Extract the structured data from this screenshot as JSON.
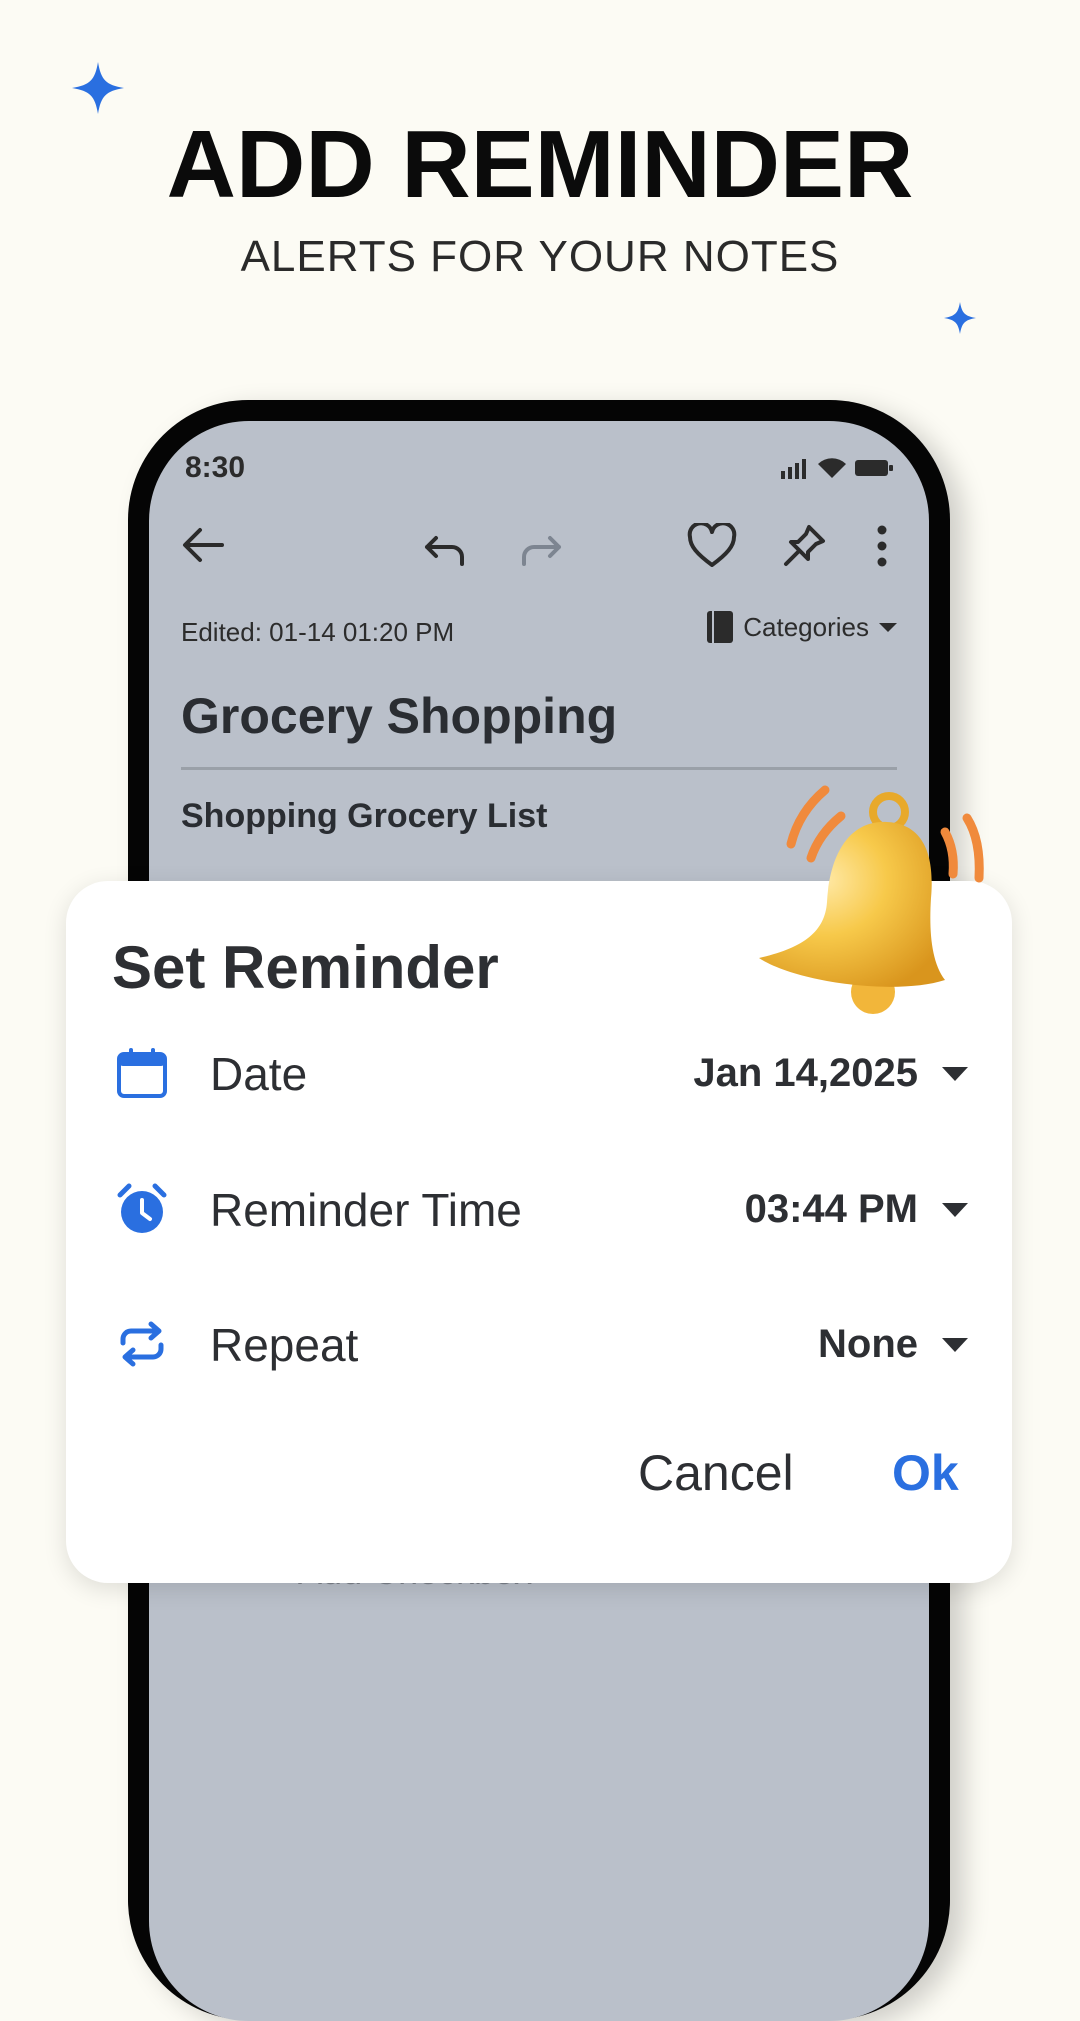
{
  "hero": {
    "title": "ADD REMINDER",
    "subtitle": "ALERTS FOR YOUR NOTES"
  },
  "status_bar": {
    "time": "8:30",
    "icons": [
      "signal-icon",
      "wifi-icon",
      "battery-icon"
    ]
  },
  "toolbar": {
    "icons": [
      "back-arrow-icon",
      "undo-icon",
      "redo-icon",
      "heart-icon",
      "pin-icon",
      "more-vertical-icon"
    ]
  },
  "note": {
    "edited": "Edited: 01-14  01:20 PM",
    "categories_label": "Categories",
    "title": "Grocery Shopping",
    "subtitle": "Shopping Grocery List",
    "add_checkbox": "+ Add Checkbox"
  },
  "dialog": {
    "title": "Set Reminder",
    "rows": [
      {
        "icon": "calendar-icon",
        "label": "Date",
        "value": "Jan 14,2025"
      },
      {
        "icon": "alarm-clock-icon",
        "label": "Reminder Time",
        "value": "03:44 PM"
      },
      {
        "icon": "repeat-icon",
        "label": "Repeat",
        "value": "None"
      }
    ],
    "cancel_label": "Cancel",
    "ok_label": "Ok"
  },
  "colors": {
    "accent": "#2a6fe0",
    "background": "#fcfbf4",
    "screen": "#bac0ca"
  }
}
